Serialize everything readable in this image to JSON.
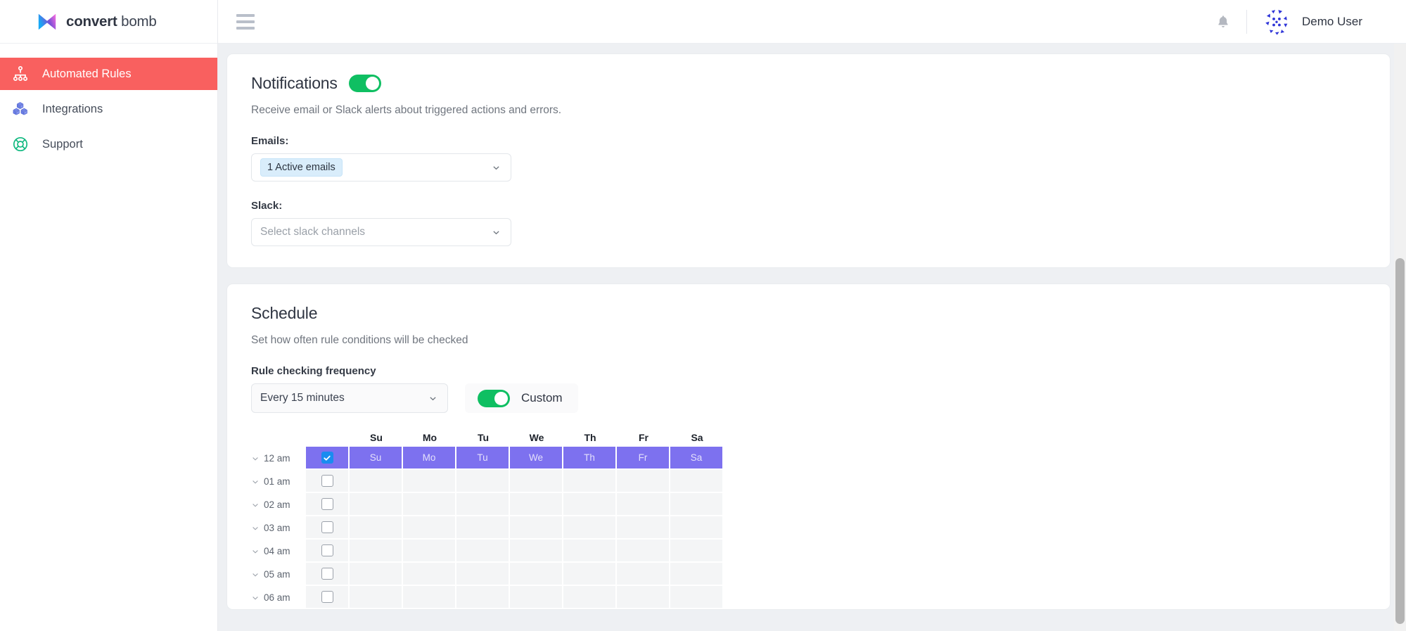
{
  "brand": {
    "name_bold": "convert",
    "name_light": " bomb",
    "logo_icon": "hourglass-logo-icon"
  },
  "sidebar": {
    "items": [
      {
        "label": "Automated Rules",
        "icon": "sitemap-icon",
        "active": true
      },
      {
        "label": "Integrations",
        "icon": "cubes-icon",
        "active": false
      },
      {
        "label": "Support",
        "icon": "life-ring-icon",
        "active": false
      }
    ]
  },
  "topbar": {
    "menu_icon": "hamburger-icon",
    "bell_icon": "bell-icon",
    "avatar_icon": "identicon-avatar",
    "user_name": "Demo User"
  },
  "notifications": {
    "title": "Notifications",
    "enabled": true,
    "description": "Receive email or Slack alerts about triggered actions and errors.",
    "emails_label": "Emails:",
    "emails_chip": "1 Active emails",
    "slack_label": "Slack:",
    "slack_placeholder": "Select slack channels"
  },
  "schedule": {
    "title": "Schedule",
    "description": "Set how often rule conditions will be checked",
    "frequency_label": "Rule checking frequency",
    "frequency_value": "Every 15 minutes",
    "custom_enabled": true,
    "custom_label": "Custom",
    "days": [
      "Su",
      "Mo",
      "Tu",
      "We",
      "Th",
      "Fr",
      "Sa"
    ],
    "rows": [
      {
        "hour": "12 am",
        "checked": true,
        "selected_days": [
          "Su",
          "Mo",
          "Tu",
          "We",
          "Th",
          "Fr",
          "Sa"
        ]
      },
      {
        "hour": "01 am",
        "checked": false,
        "selected_days": []
      },
      {
        "hour": "02 am",
        "checked": false,
        "selected_days": []
      },
      {
        "hour": "03 am",
        "checked": false,
        "selected_days": []
      },
      {
        "hour": "04 am",
        "checked": false,
        "selected_days": []
      },
      {
        "hour": "05 am",
        "checked": false,
        "selected_days": []
      },
      {
        "hour": "06 am",
        "checked": false,
        "selected_days": []
      }
    ]
  },
  "colors": {
    "accent_red": "#f9605f",
    "toggle_green": "#0fbf62",
    "grid_purple": "#7d71ef",
    "checkbox_blue": "#1a8cf0",
    "chip_blue": "#d9edfb"
  }
}
